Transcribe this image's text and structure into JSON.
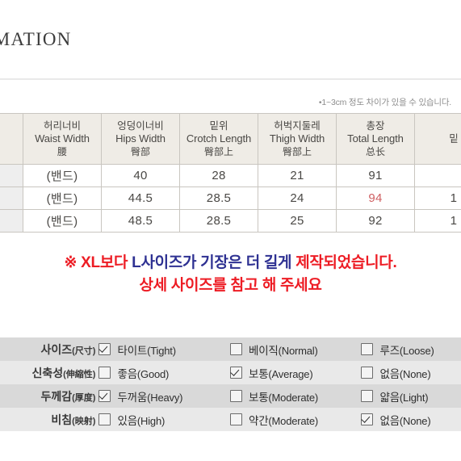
{
  "header": {
    "title": "OMATION"
  },
  "tolerance_note": "•1~3cm 정도 차이가 있을 수 있습니다.",
  "size_table": {
    "columns": [
      {
        "kr": "",
        "en": "",
        "cn": ""
      },
      {
        "kr": "허리너비",
        "en": "Waist Width",
        "cn": "腰"
      },
      {
        "kr": "엉덩이너비",
        "en": "Hips Width",
        "cn": "臀部"
      },
      {
        "kr": "밑위",
        "en": "Crotch Length",
        "cn": "臀部上"
      },
      {
        "kr": "허벅지둘레",
        "en": "Thigh Width",
        "cn": "臀部上"
      },
      {
        "kr": "총장",
        "en": "Total Length",
        "cn": "总长"
      },
      {
        "kr": "밑",
        "en": "",
        "cn": ""
      }
    ],
    "rows": [
      {
        "size": "",
        "waist": "(밴드)",
        "hips": "40",
        "crotch": "28",
        "thigh": "21",
        "total": "91",
        "extra": "",
        "total_highlight": false
      },
      {
        "size": "",
        "waist": "(밴드)",
        "hips": "44.5",
        "crotch": "28.5",
        "thigh": "24",
        "total": "94",
        "extra": "1",
        "total_highlight": true
      },
      {
        "size": "",
        "waist": "(밴드)",
        "hips": "48.5",
        "crotch": "28.5",
        "thigh": "25",
        "total": "92",
        "extra": "1",
        "total_highlight": false
      }
    ]
  },
  "warning": {
    "line1_part1": "※ XL보다 ",
    "line1_blue": "L사이즈가 기장은 더 길게",
    "line1_part2": " 제작되었습니다.",
    "line2": "상세 사이즈를 참고 해 주세요"
  },
  "spec_table": {
    "rows": [
      {
        "label_kr": "사이즈",
        "label_cn": "(尺寸)",
        "options": [
          {
            "label_kr": "타이트",
            "label_en": "(Tight)",
            "checked": true
          },
          {
            "label_kr": "베이직",
            "label_en": "(Normal)",
            "checked": false
          },
          {
            "label_kr": "루즈",
            "label_en": "(Loose)",
            "checked": false
          }
        ]
      },
      {
        "label_kr": "신축성",
        "label_cn": "(伸縮性)",
        "options": [
          {
            "label_kr": "좋음",
            "label_en": "(Good)",
            "checked": false
          },
          {
            "label_kr": "보통",
            "label_en": "(Average)",
            "checked": true
          },
          {
            "label_kr": "없음",
            "label_en": "(None)",
            "checked": false
          }
        ]
      },
      {
        "label_kr": "두께감",
        "label_cn": "(厚度)",
        "options": [
          {
            "label_kr": "두꺼움",
            "label_en": "(Heavy)",
            "checked": true
          },
          {
            "label_kr": "보통",
            "label_en": "(Moderate)",
            "checked": false
          },
          {
            "label_kr": "얇음",
            "label_en": "(Light)",
            "checked": false
          }
        ]
      },
      {
        "label_kr": "비침",
        "label_cn": "(映射)",
        "options": [
          {
            "label_kr": "있음",
            "label_en": "(High)",
            "checked": false
          },
          {
            "label_kr": "약간",
            "label_en": "(Moderate)",
            "checked": false
          },
          {
            "label_kr": "없음",
            "label_en": "(None)",
            "checked": true
          }
        ]
      }
    ]
  },
  "colors": {
    "header_bg": "#efece6",
    "highlight_red": "#cf5f62",
    "warning_red": "#ed1c24",
    "warning_blue": "#2e3192",
    "row_dark": "#d9d9d9",
    "row_light": "#e9e9e9"
  }
}
